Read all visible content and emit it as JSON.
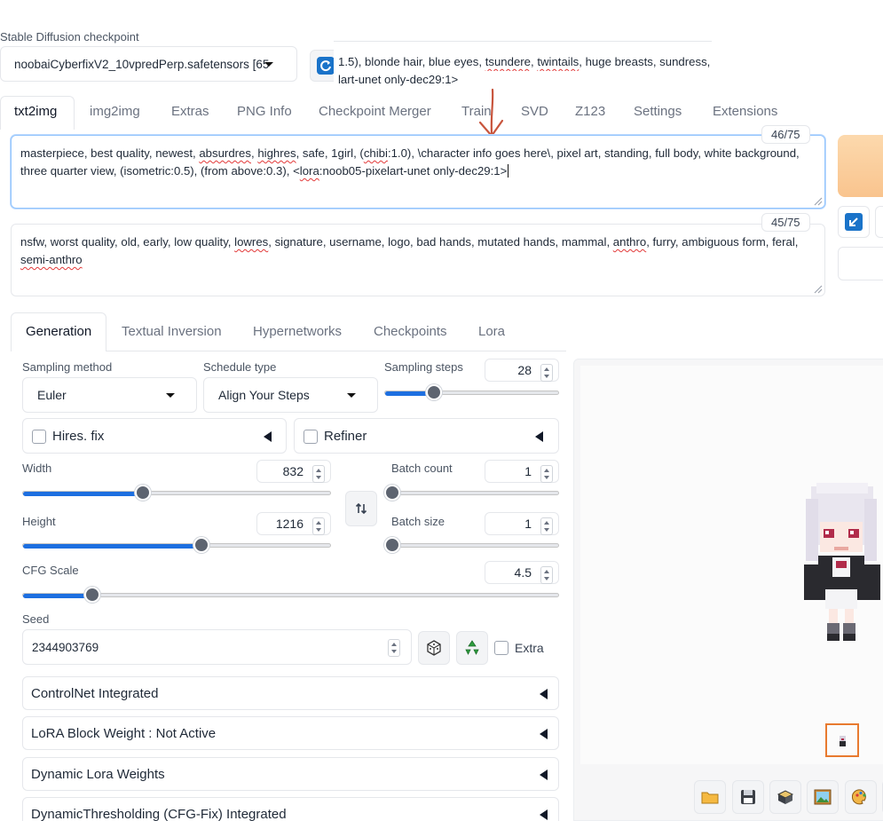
{
  "checkpoint": {
    "label": "Stable Diffusion checkpoint",
    "value": "noobaiCyberfixV2_10vpredPerp.safetensors [65"
  },
  "tooltip": {
    "line1_parts": [
      "1.5), blonde hair, blue eyes, ",
      "tsundere",
      ", ",
      "twintails",
      ", huge breasts, sundress, p"
    ],
    "line2": "lart-unet only-dec29:1>"
  },
  "tabs": [
    "txt2img",
    "img2img",
    "Extras",
    "PNG Info",
    "Checkpoint Merger",
    "Train",
    "SVD",
    "Z123",
    "Settings",
    "Extensions"
  ],
  "prompt": {
    "counter": "46/75",
    "line1_parts": [
      "masterpiece, best quality, newest, ",
      "absurdres",
      ", ",
      "highres",
      ", safe, 1girl, (",
      "chibi",
      ":1.0), \\character info goes here\\, pixel art, standing, full body, white background,"
    ],
    "line2_parts": [
      "three quarter view, (isometric:0.5), (from above:0.3), <",
      "lora",
      ":noob05-pixelart-unet only-dec29:1>"
    ]
  },
  "negative_prompt": {
    "counter": "45/75",
    "line1_parts": [
      "nsfw, worst quality, old, early, low quality, ",
      "lowres",
      ", signature, username, logo, bad hands, mutated hands, mammal, ",
      "anthro",
      ", furry, ambiguous form, feral,"
    ],
    "line2": "semi-anthro"
  },
  "subtabs": [
    "Generation",
    "Textual Inversion",
    "Hypernetworks",
    "Checkpoints",
    "Lora"
  ],
  "sampling": {
    "method_label": "Sampling method",
    "method_value": "Euler",
    "schedule_label": "Schedule type",
    "schedule_value": "Align Your Steps",
    "steps_label": "Sampling steps",
    "steps_value": "28",
    "steps_fraction": 0.28
  },
  "hires_label": "Hires. fix",
  "refiner_label": "Refiner",
  "width": {
    "label": "Width",
    "value": "832",
    "fraction": 0.39
  },
  "height": {
    "label": "Height",
    "value": "1216",
    "fraction": 0.58
  },
  "batch_count": {
    "label": "Batch count",
    "value": "1",
    "fraction": 0.0
  },
  "batch_size": {
    "label": "Batch size",
    "value": "1",
    "fraction": 0.0
  },
  "cfg": {
    "label": "CFG Scale",
    "value": "4.5",
    "fraction": 0.13
  },
  "seed": {
    "label": "Seed",
    "value": "2344903769",
    "extra_label": "Extra"
  },
  "accordions": [
    "ControlNet Integrated",
    "LoRA Block Weight : Not Active",
    "Dynamic Lora Weights",
    "DynamicThresholding (CFG-Fix) Integrated"
  ],
  "colors": {
    "accent": "#1d6fe0",
    "generate": "#fbd3a6",
    "highlight": "#e87a2f",
    "annotation": "#c8553d"
  }
}
